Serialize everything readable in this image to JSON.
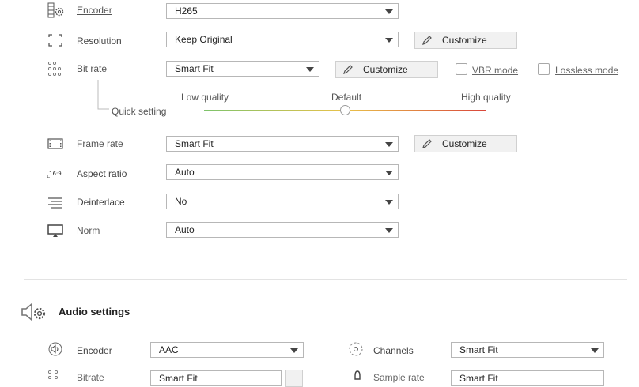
{
  "video": {
    "encoder": {
      "label": "Encoder",
      "value": "H265"
    },
    "resolution": {
      "label": "Resolution",
      "value": "Keep Original",
      "button": "Customize"
    },
    "bitrate": {
      "label": "Bit rate",
      "value": "Smart Fit",
      "button": "Customize",
      "vbr_label": "VBR mode",
      "lossless_label": "Lossless mode",
      "quick_setting": "Quick setting",
      "slider": {
        "low": "Low quality",
        "default": "Default",
        "high": "High quality",
        "level": 0.5
      }
    },
    "framerate": {
      "label": "Frame rate",
      "value": "Smart Fit",
      "button": "Customize"
    },
    "aspect": {
      "label": "Aspect ratio",
      "value": "Auto",
      "icon_text": "16:9"
    },
    "deinterlace": {
      "label": "Deinterlace",
      "value": "No"
    },
    "norm": {
      "label": "Norm",
      "value": "Auto"
    }
  },
  "audio": {
    "title": "Audio settings",
    "encoder": {
      "label": "Encoder",
      "value": "AAC"
    },
    "channels": {
      "label": "Channels",
      "value": "Smart Fit"
    },
    "bitrate": {
      "label": "Bitrate",
      "value": "Smart Fit"
    },
    "samplerate": {
      "label": "Sample rate",
      "value": "Smart Fit"
    }
  },
  "colors": {
    "slider_low": "#7dc36b",
    "slider_mid": "#e9c24a",
    "slider_high": "#d9463b",
    "button_bg": "#f1f1f1"
  },
  "icons": [
    "encoder-gear-icon",
    "resolution-frame-icon",
    "bitrate-dots-icon",
    "pencil-icon",
    "filmstrip-icon",
    "aspect-ratio-icon",
    "deinterlace-lines-icon",
    "monitor-icon",
    "speaker-gear-icon",
    "speaker-icon",
    "channels-icon"
  ]
}
